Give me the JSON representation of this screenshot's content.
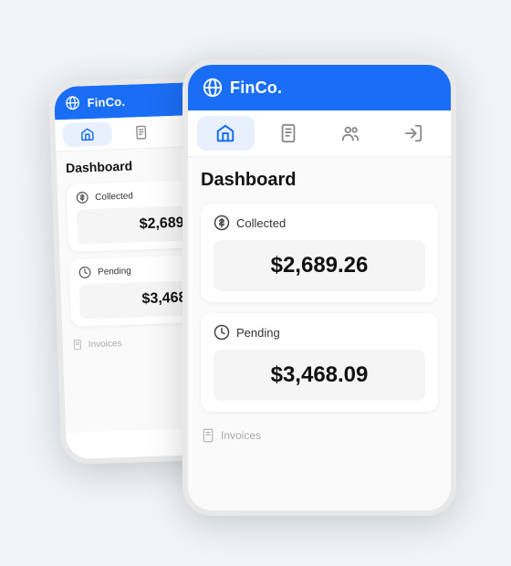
{
  "app": {
    "name": "FinCo.",
    "accent_color": "#1a6ef5"
  },
  "header": {
    "title": "Dashboard"
  },
  "nav": {
    "tabs": [
      {
        "label": "Home",
        "icon": "home",
        "active": true
      },
      {
        "label": "Documents",
        "icon": "document",
        "active": false
      },
      {
        "label": "Users",
        "icon": "users",
        "active": false
      },
      {
        "label": "Logout",
        "icon": "logout",
        "active": false
      }
    ]
  },
  "metrics": [
    {
      "label": "Collected",
      "value": "$2,689.26",
      "icon": "dollar-circle"
    },
    {
      "label": "Pending",
      "value": "$3,468.09",
      "icon": "clock"
    }
  ],
  "footer": {
    "invoices_label": "Invoices",
    "icon": "document"
  }
}
